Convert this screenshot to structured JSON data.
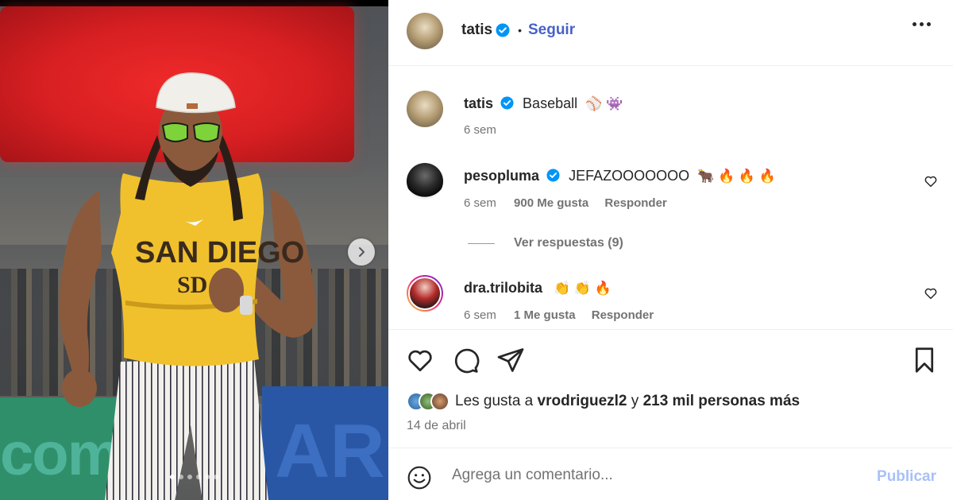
{
  "post": {
    "author": "tatis",
    "follow_label": "Seguir",
    "bullet": "•",
    "carousel": {
      "slides": 6,
      "active": 0
    }
  },
  "caption": {
    "username": "tatis",
    "text": "Baseball",
    "emoji": "⚾ 👾",
    "time": "6 sem"
  },
  "comments": [
    {
      "username": "pesopluma",
      "verified": true,
      "text": "JEFAZOOOOOOO",
      "emoji": "🐂 🔥 🔥 🔥",
      "time": "6 sem",
      "likes": "900 Me gusta",
      "reply": "Responder",
      "view_replies": "Ver respuestas (9)"
    },
    {
      "username": "dra.trilobita",
      "verified": false,
      "text": "",
      "emoji": "👏 👏 🔥",
      "time": "6 sem",
      "likes": "1 Me gusta",
      "reply": "Responder"
    }
  ],
  "likes_summary": {
    "prefix": "Les gusta a",
    "user": "vrodriguezl2",
    "joiner": "y",
    "others": "213 mil personas más"
  },
  "date": "14 de abril",
  "composer": {
    "placeholder": "Agrega un comentario...",
    "publish_label": "Publicar"
  },
  "colors": {
    "verified": "#0095f6",
    "follow": "#4762c8",
    "publish_disabled": "#a8c1f7",
    "muted": "#737373"
  },
  "icons": [
    "verified-badge-icon",
    "more-options-icon",
    "heart-icon",
    "comment-icon",
    "share-icon",
    "bookmark-icon",
    "emoji-icon",
    "chevron-right-icon"
  ]
}
